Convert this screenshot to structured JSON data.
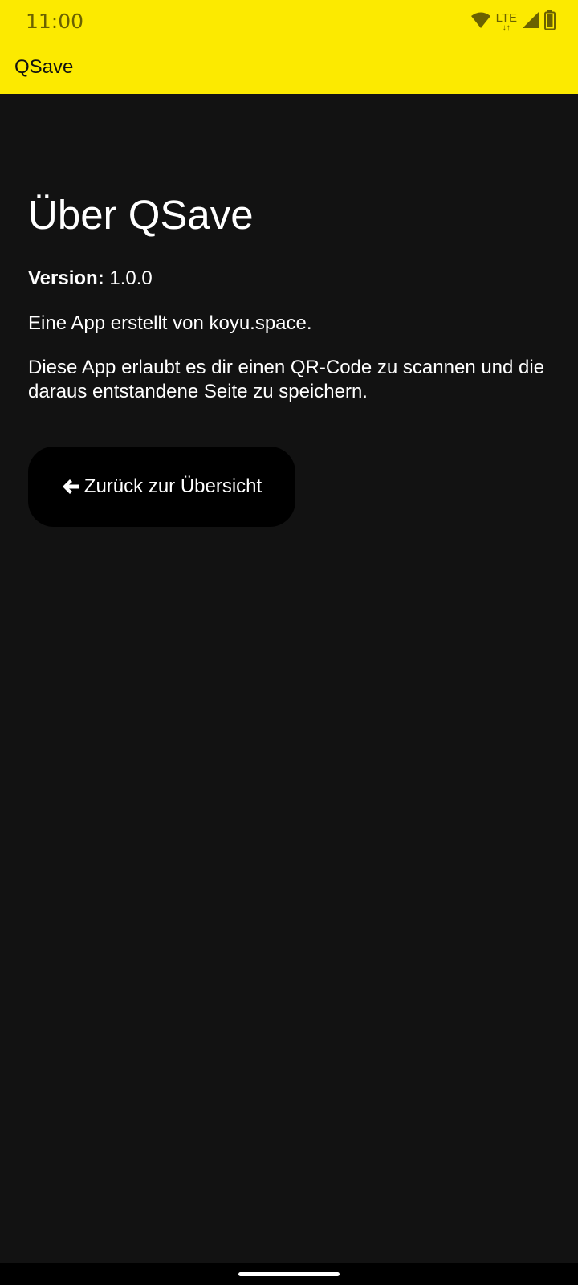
{
  "status_bar": {
    "time": "11:00",
    "network": "LTE",
    "icons": [
      "wifi-icon",
      "lte-icon",
      "signal-icon",
      "battery-icon"
    ]
  },
  "app_bar": {
    "title": "QSave"
  },
  "about": {
    "title": "Über QSave",
    "version_label": "Version:",
    "version_value": "1.0.0",
    "creator": "Eine App erstellt von koyu.space.",
    "description": "Diese App erlaubt es dir einen QR-Code zu scannen und die daraus entstandene Seite zu speichern."
  },
  "back_button": {
    "label": "Zurück zur Übersicht",
    "icon": "arrow-left-icon"
  },
  "colors": {
    "accent": "#FCEA00",
    "background": "#121212",
    "button": "#000000",
    "text": "#FFFFFF"
  }
}
